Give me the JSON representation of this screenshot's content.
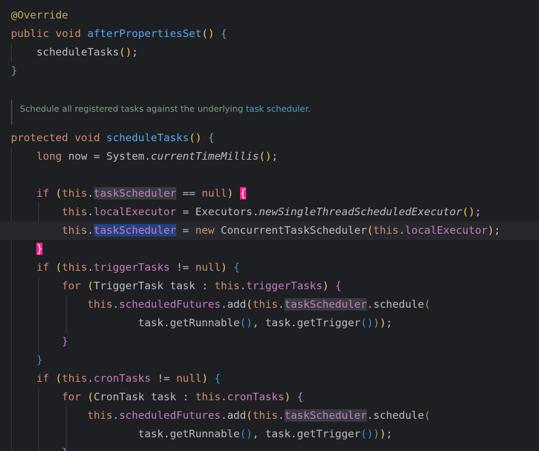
{
  "code": {
    "annotation": "@Override",
    "public_kw": "public",
    "void_kw": "void",
    "protected_kw": "protected",
    "long_kw": "long",
    "if_kw": "if",
    "for_kw": "for",
    "new_kw": "new",
    "this_kw": "this",
    "null_kw": "null",
    "method_after": "afterPropertiesSet",
    "method_schedule_tasks": "scheduleTasks",
    "call_schedule_tasks": "scheduleTasks",
    "var_now": "now",
    "system": "System",
    "current_time": "currentTimeMillis",
    "field_task_scheduler": "taskScheduler",
    "field_local_executor": "localExecutor",
    "field_trigger_tasks": "triggerTasks",
    "field_cron_tasks": "cronTasks",
    "field_scheduled_futures": "scheduledFutures",
    "executors": "Executors",
    "new_executor": "newSingleThreadScheduledExecutor",
    "concurrent_scheduler": "ConcurrentTaskScheduler",
    "trigger_task_type": "TriggerTask",
    "cron_task_type": "CronTask",
    "task_var": "task",
    "add": "add",
    "schedule": "schedule",
    "get_runnable": "getRunnable",
    "get_trigger": "getTrigger"
  },
  "doc_comment": {
    "text": "Schedule all registered tasks against the underlying ",
    "link": "task scheduler",
    "end": "."
  }
}
